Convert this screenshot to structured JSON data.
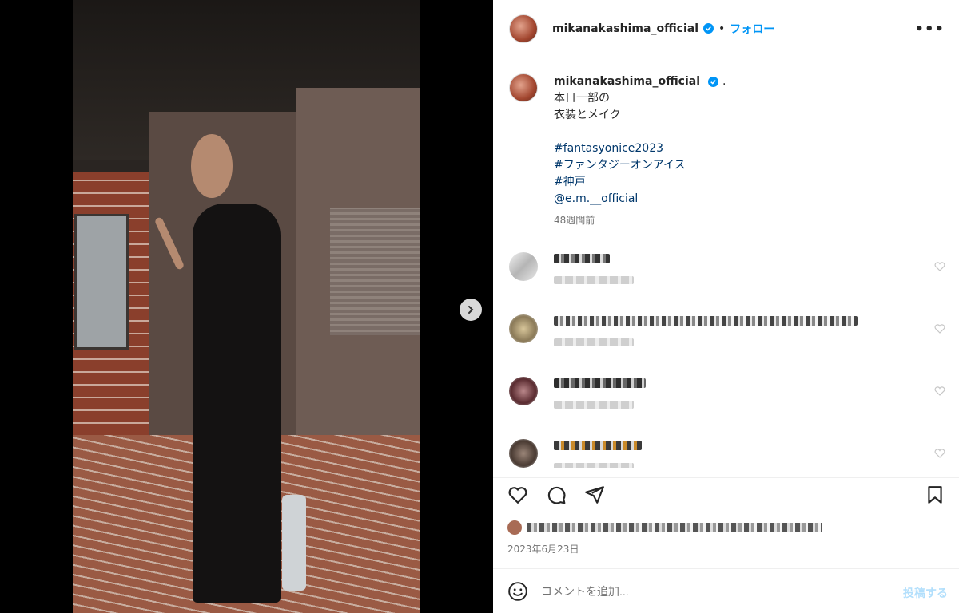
{
  "post": {
    "username": "mikanakashima_official",
    "follow_label": "フォロー",
    "separator": "•",
    "more_label": "•••"
  },
  "caption": {
    "username": "mikanakashima_official",
    "trailing": ".",
    "lines": [
      "本日一部の",
      "衣装とメイク"
    ],
    "hashtags": [
      "#fantasyonice2023",
      "#ファンタジーオンアイス",
      "#神戸",
      "@e.m.__official"
    ],
    "time": "48週間前"
  },
  "date": "2023年6月23日",
  "comment_box": {
    "placeholder": "コメントを追加...",
    "post_label": "投稿する"
  },
  "icons": {
    "verified": "verified-badge-icon",
    "next": "chevron-right-icon",
    "like": "heart-icon",
    "comment": "comment-icon",
    "share": "share-icon",
    "save": "bookmark-icon",
    "emoji": "emoji-icon"
  },
  "colors": {
    "accent": "#0095f6",
    "hashtag": "#00376b",
    "muted": "#737373",
    "post_disabled": "#b2dffc"
  }
}
